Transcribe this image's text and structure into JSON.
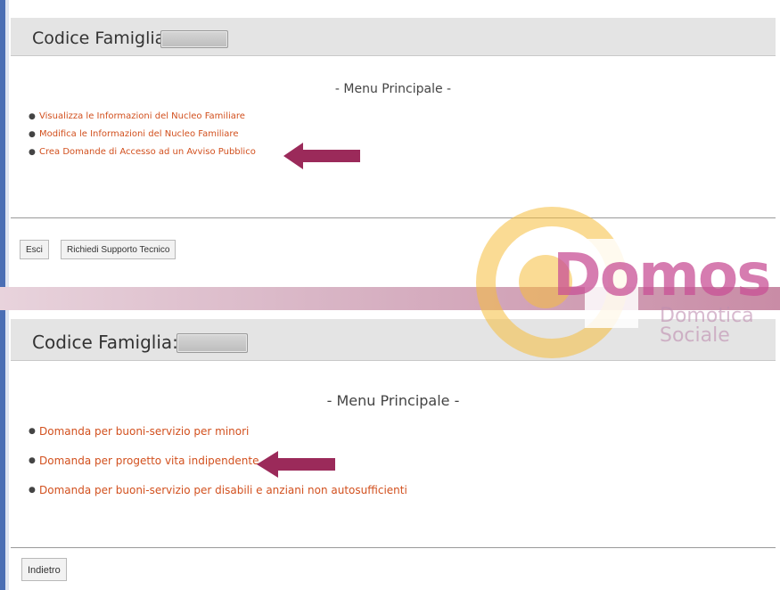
{
  "top": {
    "header": {
      "label": "Codice Famiglia:"
    },
    "menu_title": "- Menu Principale -",
    "menu_items": [
      "Visualizza le Informazioni del Nucleo Familiare",
      "Modifica le Informazioni del Nucleo Familiare",
      "Crea Domande di Accesso ad un Avviso Pubblico"
    ],
    "buttons": {
      "exit": "Esci",
      "support": "Richiedi Supporto Tecnico"
    }
  },
  "bottom": {
    "header": {
      "label": "Codice Famiglia:"
    },
    "menu_title": "- Menu Principale -",
    "menu_items": [
      "Domanda per buoni-servizio per minori",
      "Domanda per progetto vita indipendente",
      "Domanda per buoni-servizio per disabili e anziani non autosufficienti"
    ],
    "buttons": {
      "back": "Indietro"
    }
  },
  "logo": {
    "name": "Domos",
    "subtitle_line1": "Domotica",
    "subtitle_line2": "Sociale"
  },
  "colors": {
    "link": "#d2501e",
    "arrow": "#9b2a5a",
    "header_bg": "#e4e4e4"
  },
  "icons": {
    "arrow": "left-arrow-icon",
    "bullet": "bullet-icon"
  }
}
